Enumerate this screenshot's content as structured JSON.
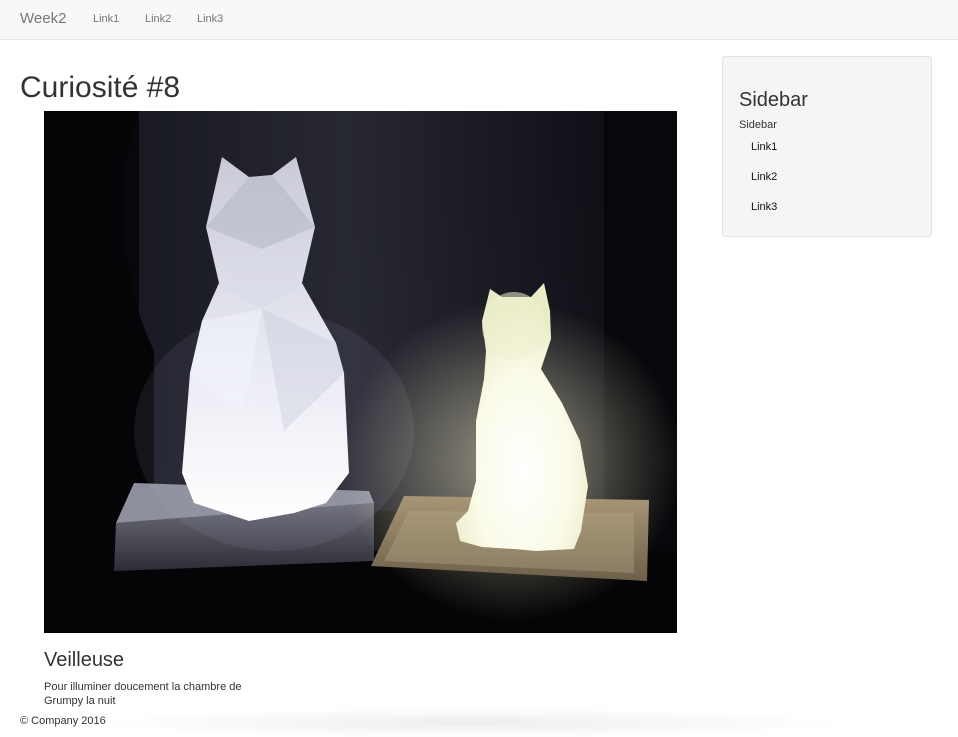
{
  "navbar": {
    "brand": "Week2",
    "links": [
      "Link1",
      "Link2",
      "Link3"
    ]
  },
  "main": {
    "title": "Curiosité #8",
    "caption": {
      "title": "Veilleuse",
      "text": "Pour illuminer doucement la chambre de Grumpy la nuit"
    }
  },
  "sidebar": {
    "title": "Sidebar",
    "subtitle": "Sidebar",
    "links": [
      "Link1",
      "Link2",
      "Link3"
    ]
  },
  "footer": {
    "text": "© Company 2016"
  }
}
